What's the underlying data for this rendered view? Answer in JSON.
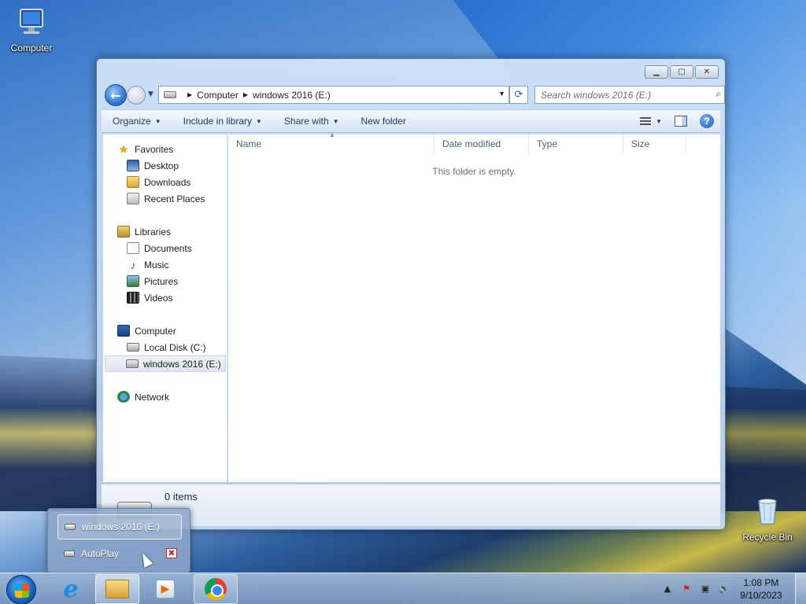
{
  "desktop": {
    "computer_label": "Computer",
    "recycle_label": "Recycle Bin"
  },
  "window": {
    "address": {
      "segments": [
        "Computer",
        "windows 2016 (E:)"
      ]
    },
    "search": {
      "placeholder": "Search windows 2016 (E:)"
    },
    "toolbar": {
      "organize": "Organize",
      "include_in_library": "Include in library",
      "share_with": "Share with",
      "new_folder": "New folder"
    },
    "nav": {
      "favorites": "Favorites",
      "desktop": "Desktop",
      "downloads": "Downloads",
      "recent_places": "Recent Places",
      "libraries": "Libraries",
      "documents": "Documents",
      "music": "Music",
      "pictures": "Pictures",
      "videos": "Videos",
      "computer": "Computer",
      "local_disk": "Local Disk (C:)",
      "windows_drive": "windows 2016 (E:)",
      "network": "Network"
    },
    "columns": {
      "name": "Name",
      "date_modified": "Date modified",
      "type": "Type",
      "size": "Size"
    },
    "empty_message": "This folder is empty.",
    "details": {
      "item_count": "0 items"
    }
  },
  "popup": {
    "drive_label": "windows 2016 (E:)",
    "autoplay_label": "AutoPlay"
  },
  "taskbar": {
    "clock_time": "1:08 PM",
    "clock_date": "9/10/2023"
  }
}
